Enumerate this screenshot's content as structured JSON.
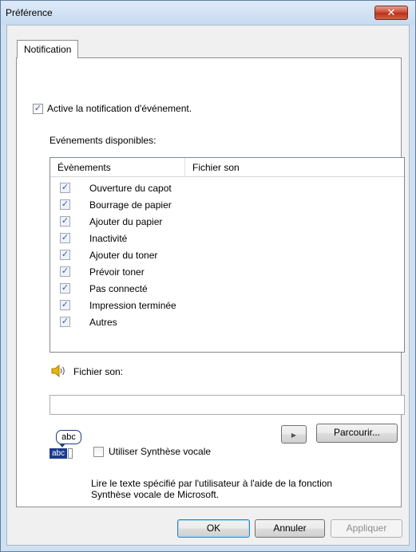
{
  "window": {
    "title": "Préférence",
    "close_symbol": "✕"
  },
  "tabs": [
    {
      "label": "Notification"
    }
  ],
  "notification": {
    "enable_label": "Active la notification d'événement.",
    "enable_checked": true,
    "available_events_label": "Evénements disponibles:",
    "columns": [
      "Évènements",
      "Fichier son"
    ],
    "events": [
      {
        "label": "Ouverture du capot",
        "checked": true,
        "sound": ""
      },
      {
        "label": "Bourrage de papier",
        "checked": true,
        "sound": ""
      },
      {
        "label": "Ajouter du papier",
        "checked": true,
        "sound": ""
      },
      {
        "label": "Inactivité",
        "checked": true,
        "sound": ""
      },
      {
        "label": "Ajouter du toner",
        "checked": true,
        "sound": ""
      },
      {
        "label": "Prévoir toner",
        "checked": true,
        "sound": ""
      },
      {
        "label": "Pas connecté",
        "checked": true,
        "sound": ""
      },
      {
        "label": "Impression terminée",
        "checked": true,
        "sound": ""
      },
      {
        "label": "Autres",
        "checked": true,
        "sound": ""
      }
    ],
    "sound_file_label": "Fichier son:",
    "sound_file_value": "",
    "play_symbol": "▶",
    "browse_label": "Parcourir...",
    "tts_icon_text_top": "abc",
    "tts_icon_text_bottom": "abc",
    "tts_label": "Utiliser Synthèse vocale",
    "tts_checked": false,
    "tts_description": "Lire le texte spécifié par l'utilisateur à l'aide de la fonction Synthèse vocale de Microsoft."
  },
  "footer": {
    "ok_label": "OK",
    "cancel_label": "Annuler",
    "apply_label": "Appliquer"
  },
  "check_mark": "✓"
}
